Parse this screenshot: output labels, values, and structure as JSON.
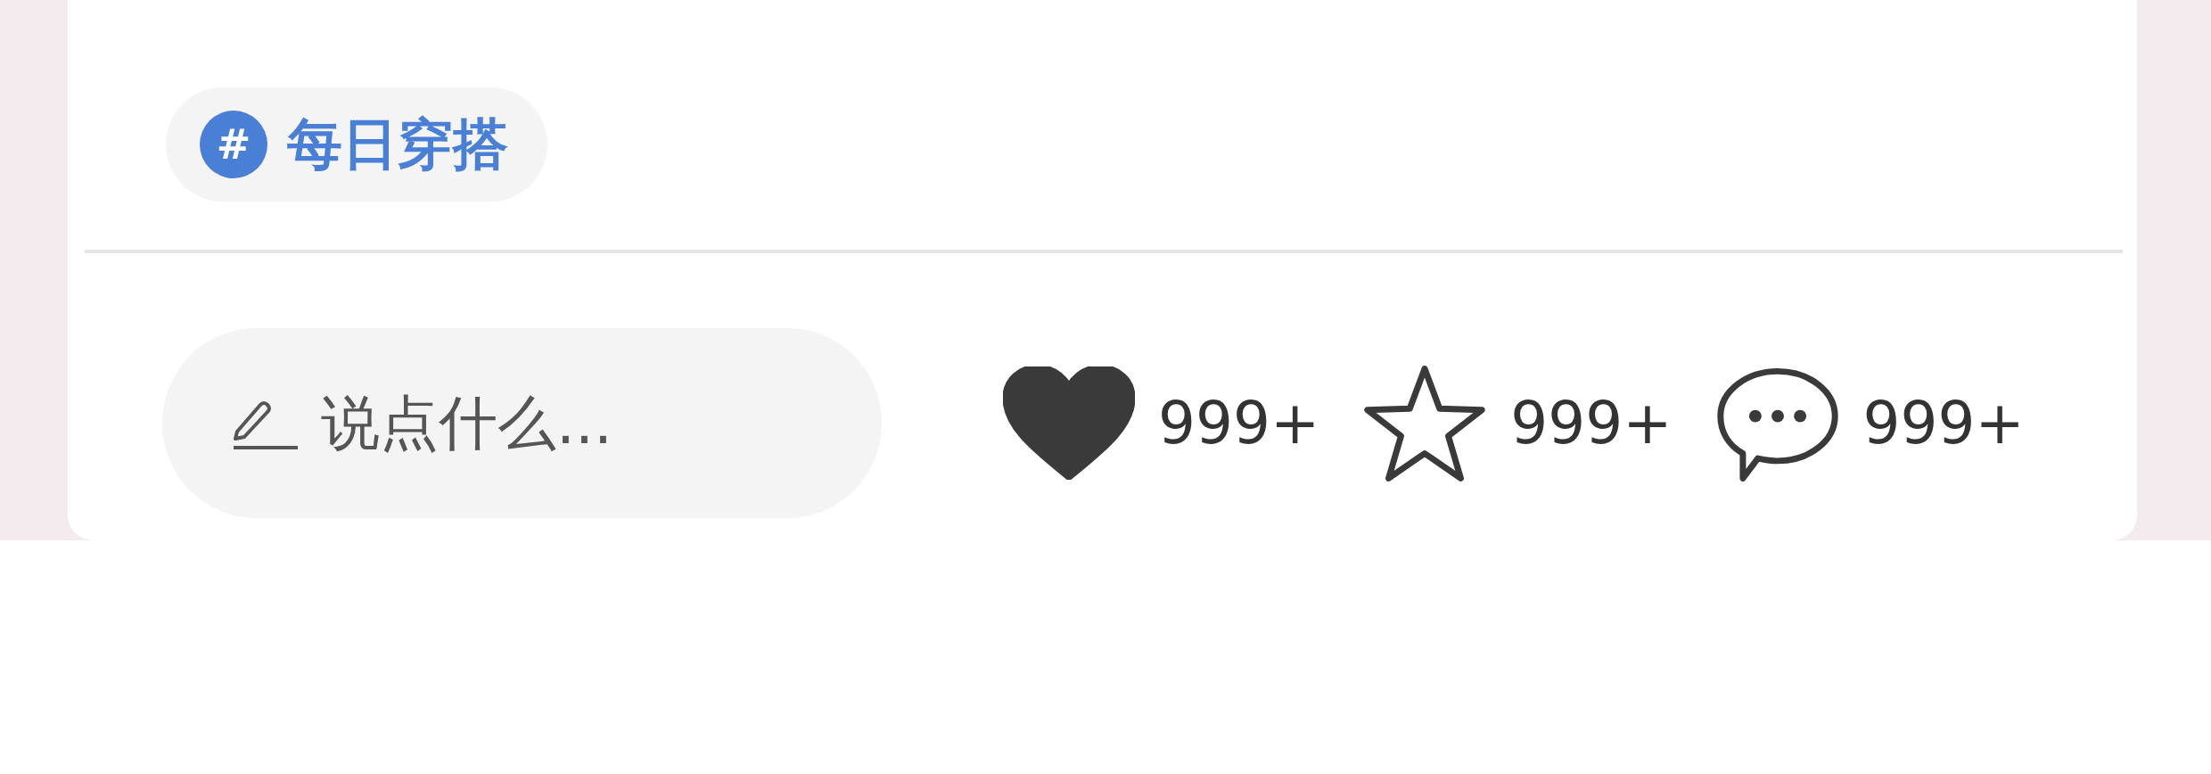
{
  "tag": {
    "icon": "#",
    "label": "每日穿搭"
  },
  "comment_field": {
    "placeholder": "说点什么..."
  },
  "actions": [
    {
      "kind": "like",
      "active": true,
      "count": "999+"
    },
    {
      "kind": "collect",
      "active": false,
      "count": "999+"
    },
    {
      "kind": "comment",
      "count": "999+"
    }
  ]
}
